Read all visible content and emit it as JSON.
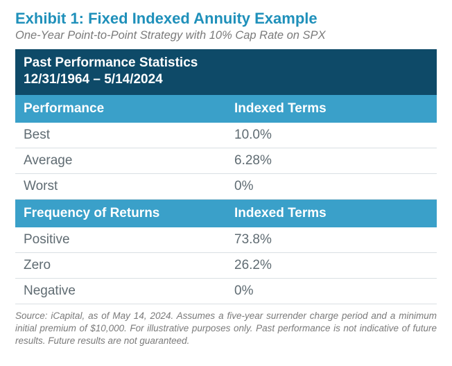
{
  "title": "Exhibit 1: Fixed Indexed Annuity Example",
  "subtitle": "One-Year Point-to-Point Strategy with 10% Cap Rate on SPX",
  "band_line1": "Past Performance Statistics",
  "band_line2": "12/31/1964 – 5/14/2024",
  "section1": {
    "left": "Performance",
    "right": "Indexed Terms",
    "rows": [
      {
        "label": "Best",
        "value": "10.0%"
      },
      {
        "label": "Average",
        "value": "6.28%"
      },
      {
        "label": "Worst",
        "value": "0%"
      }
    ]
  },
  "section2": {
    "left": "Frequency of Returns",
    "right": "Indexed Terms",
    "rows": [
      {
        "label": "Positive",
        "value": "73.8%"
      },
      {
        "label": "Zero",
        "value": "26.2%"
      },
      {
        "label": "Negative",
        "value": "0%"
      }
    ]
  },
  "footnote": "Source: iCapital, as of May 14, 2024. Assumes a five-year surrender charge period and a minimum initial premium of $10,000. For illustrative purposes only. Past performance is not indicative of future results. Future results are not guaranteed.",
  "chart_data": {
    "type": "table",
    "title": "Past Performance Statistics 12/31/1964 – 5/14/2024",
    "sections": [
      {
        "name": "Performance",
        "column": "Indexed Terms",
        "rows": {
          "Best": "10.0%",
          "Average": "6.28%",
          "Worst": "0%"
        }
      },
      {
        "name": "Frequency of Returns",
        "column": "Indexed Terms",
        "rows": {
          "Positive": "73.8%",
          "Zero": "26.2%",
          "Negative": "0%"
        }
      }
    ]
  }
}
